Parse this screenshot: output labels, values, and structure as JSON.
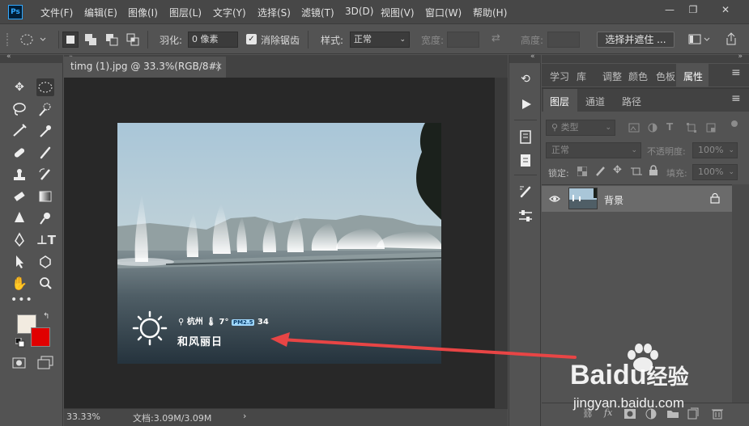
{
  "app": {
    "logo": "Ps"
  },
  "menu": {
    "items": [
      "文件(F)",
      "编辑(E)",
      "图像(I)",
      "图层(L)",
      "文字(Y)",
      "选择(S)",
      "滤镜(T)",
      "3D(D)",
      "视图(V)",
      "窗口(W)",
      "帮助(H)"
    ]
  },
  "window_controls": {
    "minimize": "—",
    "restore": "❐",
    "close": "✕"
  },
  "options": {
    "feather_label": "羽化:",
    "feather_value": "0 像素",
    "antialias_label": "消除锯齿",
    "style_label": "样式:",
    "style_value": "正常",
    "width_label": "宽度:",
    "height_label": "高度:",
    "select_mask_button": "选择并遮住 ..."
  },
  "document": {
    "tab_title": "timg (1).jpg @ 33.3%(RGB/8#)",
    "tab_close": "×",
    "zoom": "33.33%",
    "doc_size": "文档:3.09M/3.09M",
    "status_arrow": "›"
  },
  "photo_overlay": {
    "location": "杭州",
    "temperature": "7°",
    "pm_badge": "PM2.5",
    "pm_value": "34",
    "weather": "和风丽日"
  },
  "panels": {
    "top_tabs": [
      "学习",
      "库",
      "调整",
      "颜色",
      "色板",
      "属性"
    ],
    "layer_tabs": [
      "图层",
      "通道",
      "路径"
    ],
    "filter_kind": "类型",
    "blend_mode": "正常",
    "opacity_label": "不透明度:",
    "opacity_value": "100%",
    "lock_label": "锁定:",
    "fill_label": "填充:",
    "fill_value": "100%",
    "layers": [
      {
        "name": "背景"
      }
    ]
  },
  "watermark": {
    "brand": "Bai",
    "brand2": "du",
    "cn": "经验",
    "url": "jingyan.baidu.com"
  },
  "colors": {
    "foreground": "#f2ebe0",
    "background": "#e00000",
    "arrow": "#e84545"
  }
}
